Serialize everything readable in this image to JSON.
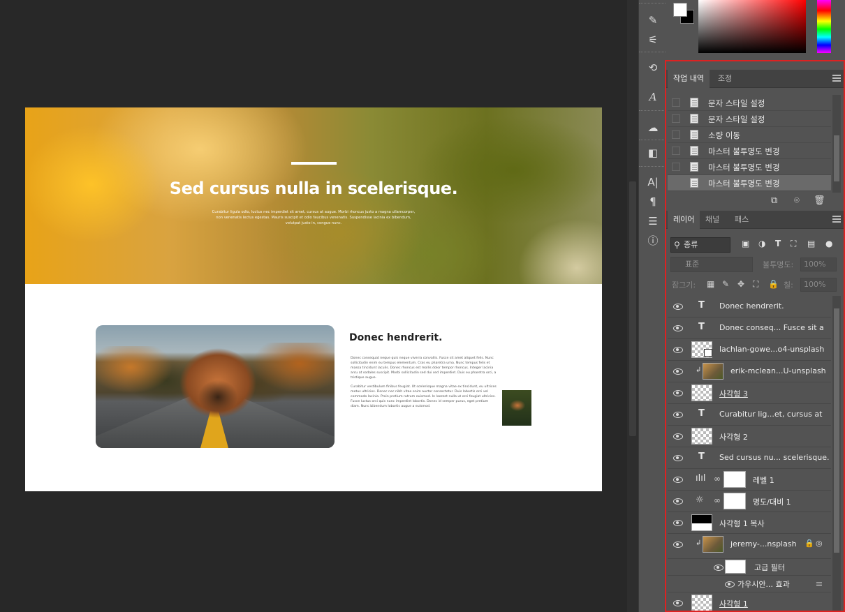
{
  "canvas": {
    "hero_title": "Sed cursus nulla in scelerisque.",
    "hero_sub": "Curabitur ligula odio, luctus nec imperdiet sit amet, cursus at augue. Morbi rhoncus justo a magna ullamcorper, non venenatis lectus egestas. Mauris suscipit et odio faucibus venenatis. Suspendisse lacinia ex bibendum, volutpat justo in, congue nunc.",
    "section_title": "Donec hendrerit.",
    "section_p1": "Donec consequat neque quis neque viverra convallis. Fusce sit amet aliquet felis. Nunc sollicitudin enim eu tempus elementum. Cras eu pharetra urna. Nunc tempus felis et massa tincidunt iaculis. Donec rhoncus est mollis dolor tempor rhoncus. Integer lacinia arcu at sodales suscipit. Morbi sollicitudin sed dui sed imperdiet. Duis eu pharetra orci, a tristique augue.",
    "section_p2": "Curabitur vestibulum finibus feugiat. Ut scelerisque magna vitae ex tincidunt, eu ultrices metus ultricies. Donec nec nibh vitae enim auctor consectetur. Duis lobortis orci vel commodo lacinia. Proin pretium rutrum euismod. In laoreet nulla ut orci feugiat ultricies. Fusce luctus orci quis nunc imperdiet lobortis. Donec id semper purus, eget pretium diam. Nunc bibendum lobortis augue a euismod."
  },
  "color": {
    "foreground": "#ffffff",
    "background": "#000000"
  },
  "history_panel": {
    "tabs": [
      "작업 내역",
      "조정"
    ],
    "items": [
      "문자 스타일 설정",
      "문자 스타일 설정",
      "소량 이동",
      "마스터 불투명도 변경",
      "마스터 불투명도 변경",
      "마스터 불투명도 변경"
    ],
    "selected_index": 5
  },
  "layers_panel": {
    "tabs": [
      "레이어",
      "채널",
      "패스"
    ],
    "kind_filter": "종류",
    "blend_mode": "표준",
    "opacity_label": "불투명도:",
    "opacity_value": "100%",
    "lock_label": "잠그기:",
    "fill_label": "칠:",
    "fill_value": "100%",
    "layers": [
      {
        "kind": "text",
        "name": "Donec hendrerit."
      },
      {
        "kind": "text",
        "name": "Donec conseq... Fusce sit a"
      },
      {
        "kind": "smart",
        "name": "lachlan-gowe...o4-unsplash"
      },
      {
        "kind": "smart-clip",
        "name": "erik-mclean...U-unsplash"
      },
      {
        "kind": "shape",
        "name": "사각형 3"
      },
      {
        "kind": "text",
        "name": "Curabitur lig...et, cursus at"
      },
      {
        "kind": "shape",
        "name": "사각형 2"
      },
      {
        "kind": "text",
        "name": "Sed cursus nu... scelerisque."
      },
      {
        "kind": "adjust-levels",
        "name": "레벨 1"
      },
      {
        "kind": "adjust-brightness",
        "name": "명도/대비 1"
      },
      {
        "kind": "shape-black",
        "name": "사각형 1 복사"
      },
      {
        "kind": "smart-photo",
        "name": "jeremy-...nsplash"
      },
      {
        "kind": "filter",
        "name": "고급 필터"
      },
      {
        "kind": "filter-item",
        "name": "가우시안... 효과"
      },
      {
        "kind": "shape",
        "name": "사각형 1"
      }
    ]
  }
}
